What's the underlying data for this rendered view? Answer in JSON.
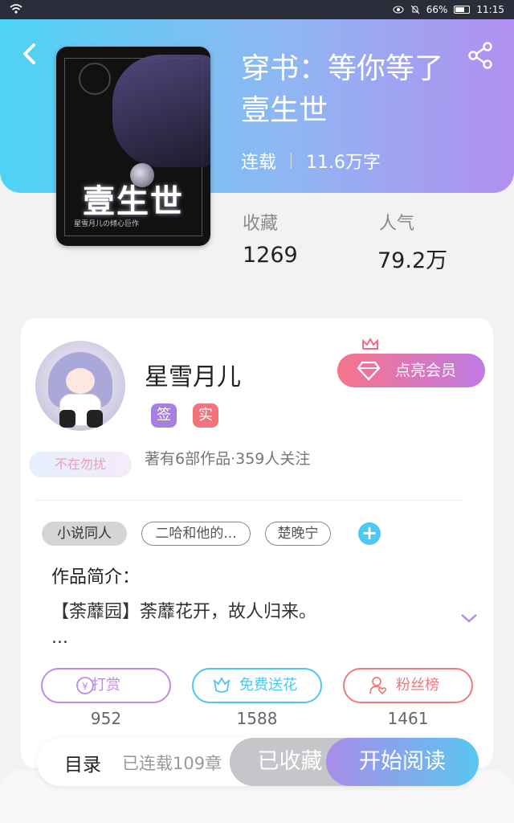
{
  "status_bar": {
    "battery": "66%",
    "time": "11:15"
  },
  "book": {
    "title": "穿书：等你等了壹生世",
    "cover_title": "壹生世",
    "cover_subtitle": "星雪月儿の倾心巨作",
    "status": "连载",
    "word_count": "11.6万字",
    "favorites_label": "收藏",
    "favorites_value": "1269",
    "popularity_label": "人气",
    "popularity_value": "79.2万"
  },
  "author": {
    "name": "星雪月儿",
    "badge_sign": "签",
    "badge_real": "实",
    "dnd_label": "不在勿扰",
    "works_info": "著有6部作品·359人关注",
    "vip_button": "点亮会员"
  },
  "tags": [
    "小说同人",
    "二哈和他的...",
    "楚晚宁"
  ],
  "intro": {
    "heading": "作品简介：",
    "text": "【荼蘼园】荼蘼花开，故人归来。",
    "ellipsis": "..."
  },
  "actions": [
    {
      "label": "打赏",
      "count": "952",
      "color": "#c08ae6"
    },
    {
      "label": "免费送花",
      "count": "1588",
      "color": "#4fc6ef"
    },
    {
      "label": "粉丝榜",
      "count": "1461",
      "color": "#f07a7a"
    }
  ],
  "bottom": {
    "catalog": "目录",
    "serial_info": "已连载109章",
    "collected": "已收藏",
    "start_reading": "开始阅读"
  }
}
